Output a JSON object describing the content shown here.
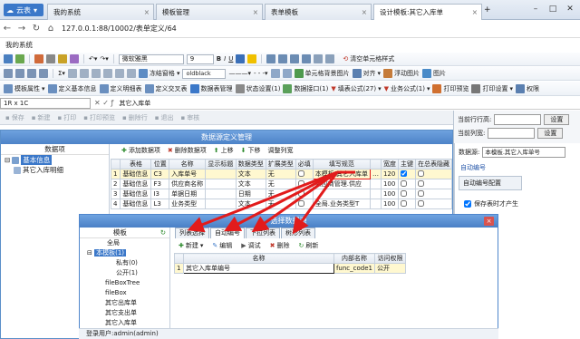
{
  "titlebar": {
    "app_button": "云表",
    "tabs": [
      "我的系统",
      "模板管理",
      "表单模板",
      "设计模板:其它入库单"
    ],
    "tab_close": "×"
  },
  "address": {
    "url": "127.0.0.1:88/10002/表单定义/64"
  },
  "sysrow": {
    "label": "我的系统"
  },
  "toolbar1": {
    "font_name": "微软雅黑",
    "font_size": "9",
    "clear_format": "清空单元格样式"
  },
  "toolbar2": {
    "freeze": "冻结窗格",
    "font_style": "oldblack",
    "cell_image": "单元格背景图片",
    "align": "对齐",
    "float_image": "浮动图片",
    "image": "图片"
  },
  "toolbar3": {
    "items": [
      "模板属性",
      "定义基本信息",
      "定义明细表",
      "定义交叉表",
      "数据表管理",
      "状态设置(1)",
      "数据接口(1)",
      "填表公式(27)",
      "业务公式(1)",
      "打印预览",
      "打印设置",
      "权限"
    ]
  },
  "cellbar": {
    "ref": "1R x 1C",
    "value": "其它入库单"
  },
  "actbar": {
    "items": [
      "保存",
      "新建",
      "打印",
      "打印预览",
      "删除行",
      "退出",
      "审核"
    ]
  },
  "rightpanel": {
    "current_row_label": "当前行行高:",
    "set_button": "设置",
    "col_width_label": "当前列宽:",
    "set_button2": "设置"
  },
  "dsdlg": {
    "title": "数据源定义管理",
    "left_header": "数据项",
    "tree": [
      "基本信息",
      "其它入库明细"
    ],
    "toolbar": [
      "添加数据项",
      "删除数据项",
      "上移",
      "下移",
      "调整列宽"
    ],
    "columns": [
      "",
      "表格",
      "位置",
      "名称",
      "显示标题",
      "数据类型",
      "扩展类型",
      "必填",
      "填写规范",
      "",
      "宽度",
      "主键",
      "在总表隐藏"
    ],
    "rows": [
      {
        "n": "1",
        "table": "基础信息",
        "pos": "C3",
        "name": "入库单号",
        "dtype": "文本",
        "ext": "无",
        "rule": "本模板.其它入库单",
        "width": "120"
      },
      {
        "n": "2",
        "table": "基础信息",
        "pos": "F3",
        "name": "供应商名称",
        "dtype": "文本",
        "ext": "无",
        "rule": "供应商管理.供应",
        "width": "100"
      },
      {
        "n": "3",
        "table": "基础信息",
        "pos": "I3",
        "name": "单据日期",
        "dtype": "日期",
        "ext": "无",
        "rule": "",
        "width": "100"
      },
      {
        "n": "4",
        "table": "基础信息",
        "pos": "L3",
        "name": "业务类型",
        "dtype": "文本",
        "ext": "无",
        "rule": "全局.业务类型T",
        "width": "100"
      }
    ]
  },
  "ds_right": {
    "datasource_label": "数据源:",
    "datasource_value": "本模板.其它入库单号",
    "auto_number": "自动编号",
    "auto_number_config": "自动编号配置",
    "save_generate": "保存表时才产生"
  },
  "lkdlg": {
    "title": "选择数据源",
    "close": "×",
    "left_header": "模板",
    "tree": [
      "全局",
      "本模板(1)",
      "私有(0)",
      "公开(1)",
      "fileBoxTree",
      "fileBox",
      "其它出库单",
      "其它支出单",
      "其它入库单"
    ],
    "tabs": [
      "列表选择",
      "自动编号",
      "下拉列表",
      "树形列表"
    ],
    "toolbar": [
      "新建",
      "编辑",
      "调试",
      "删除",
      "刷新"
    ],
    "columns": [
      "",
      "名称",
      "内部名称",
      "访问权限"
    ],
    "rows": [
      {
        "n": "1",
        "name": "其它入库单编号",
        "inner": "func_code1",
        "access": "公开"
      }
    ]
  },
  "statusbar": {
    "text": "登录用户:admin(admin)"
  }
}
